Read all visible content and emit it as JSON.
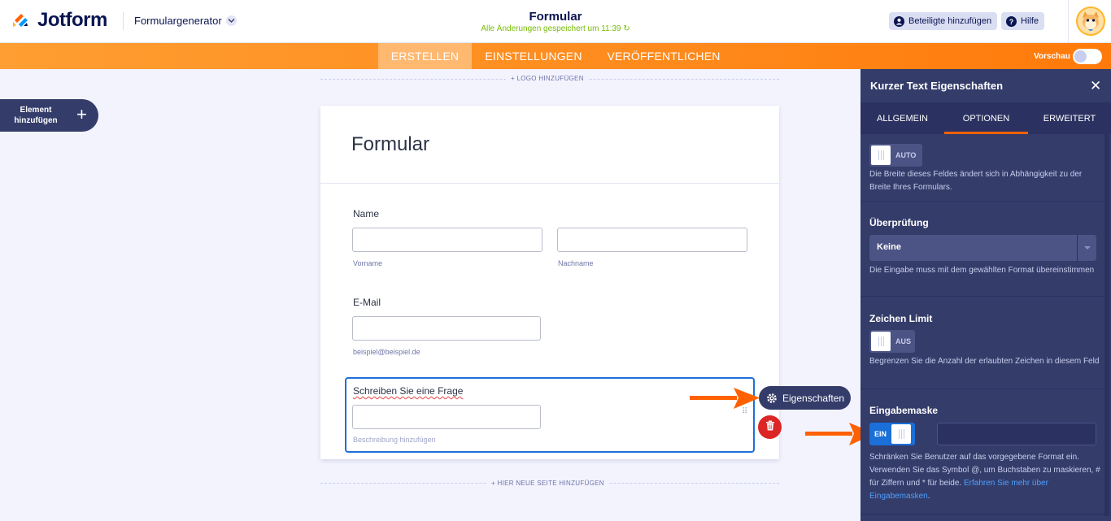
{
  "header": {
    "brand": "Jotform",
    "breadcrumb": "Formulargenerator",
    "title": "Formular",
    "save_status": "Alle Änderungen gespeichert um 11:39",
    "add_participants": "Beteiligte hinzufügen",
    "help": "Hilfe"
  },
  "tabs": [
    {
      "label": "ERSTELLEN",
      "active": true
    },
    {
      "label": "EINSTELLUNGEN",
      "active": false
    },
    {
      "label": "VERÖFFENTLICHEN",
      "active": false
    }
  ],
  "preview_label": "Vorschau",
  "add_element": "Element hinzufügen",
  "canvas": {
    "add_logo": "+ LOGO HINZUFÜGEN",
    "form_title": "Formular",
    "fields": {
      "name_label": "Name",
      "first_sub": "Vorname",
      "last_sub": "Nachname",
      "email_label": "E-Mail",
      "email_sub": "beispiel@beispiel.de",
      "question_label": "Schreiben Sie eine Frage",
      "question_sub": "Beschreibung hinzufügen"
    },
    "add_page": "+ HIER NEUE SEITE HINZUFÜGEN",
    "properties_button": "Eigenschaften"
  },
  "panel": {
    "title": "Kurzer Text Eigenschaften",
    "tabs": [
      "ALLGEMEIN",
      "OPTIONEN",
      "ERWEITERT"
    ],
    "active_tab": "OPTIONEN",
    "width": {
      "toggle": "AUTO",
      "desc": "Die Breite dieses Feldes ändert sich in Abhängigkeit zu der Breite Ihres Formulars."
    },
    "validation": {
      "title": "Überprüfung",
      "value": "Keine",
      "desc": "Die Eingabe muss mit dem gewählten Format übereinstimmen"
    },
    "char_limit": {
      "title": "Zeichen Limit",
      "toggle": "AUS",
      "desc": "Begrenzen Sie die Anzahl der erlaubten Zeichen in diesem Feld"
    },
    "input_mask": {
      "title": "Eingabemaske",
      "toggle": "EIN",
      "desc": "Schränken Sie Benutzer auf das vorgegebene Format ein. Verwenden Sie das Symbol @, um Buchstaben zu maskieren, # für Ziffern und * für beide.",
      "link": "Erfahren Sie mehr über Eingabemasken",
      "link_suffix": "."
    }
  },
  "colors": {
    "orange": "#ff8a1c",
    "navy": "#0a1551",
    "panel": "#343c6a",
    "accent_blue": "#1a6fd8",
    "arrow": "#ff6100"
  }
}
